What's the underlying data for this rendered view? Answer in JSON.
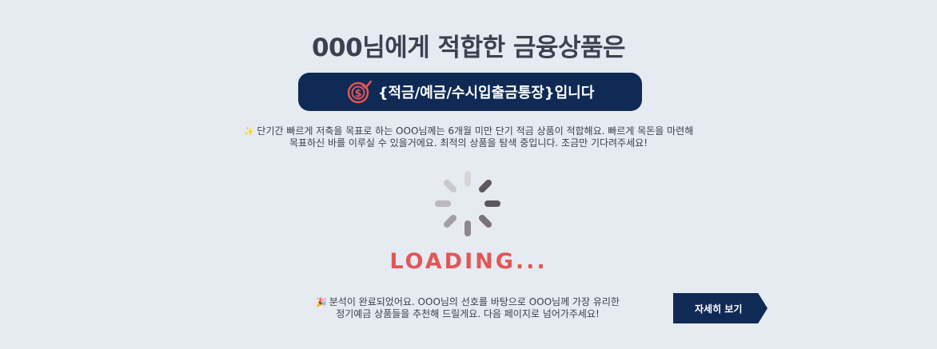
{
  "header": {
    "title": "000님에게 적합한 금융상품은"
  },
  "result": {
    "icon": "dollar-check-icon",
    "text": "{적금/예금/수시입출금통장}입니다",
    "colors": {
      "pill_bg": "#0f2a55",
      "icon": "#e25656"
    }
  },
  "description": {
    "icon": "sparkle-icon",
    "line1": "단기간 빠르게 저축을 목표로 하는 OOO님께는 6개월 미만 단기 적금 상품이 적합해요. 빠르게 목돈을 마련해",
    "line2": "목표하신 바를 이루실 수 있을거에요. 최적의 상품을 탐색 중입니다. 조금만 기다려주세요!"
  },
  "loading": {
    "text": "LOADING...",
    "icon": "spinner-icon",
    "color": "#e25656"
  },
  "completion": {
    "icon": "party-popper-icon",
    "line1": "분석이 완료되었어요. OOO님의 선호를 바탕으로 OOO님께 가장 유리한",
    "line2": "정기예금 상품들을 추천해 드릴게요. 다음 페이지로 넘어가주세요!"
  },
  "actions": {
    "detail_label": "자세히 보기"
  }
}
